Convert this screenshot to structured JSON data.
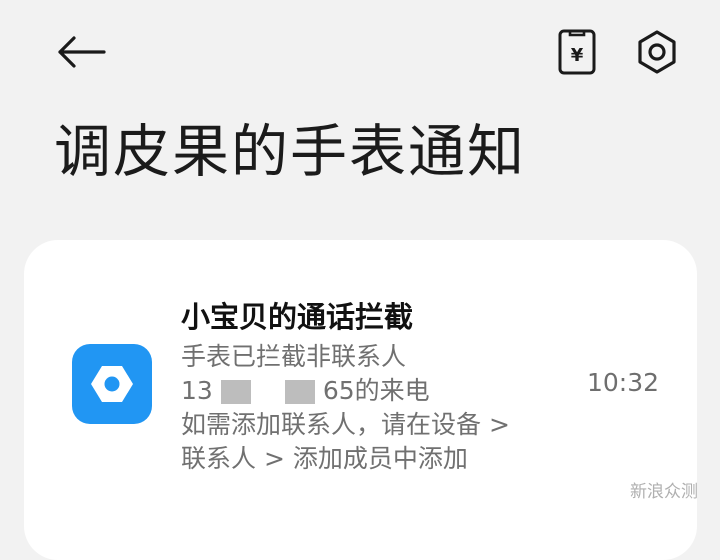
{
  "header": {
    "title": "调皮果的手表通知",
    "back_icon": "arrow-left-icon",
    "wallet_icon": "wallet-card-icon",
    "settings_icon": "hexagon-settings-icon",
    "wallet_symbol": "¥"
  },
  "notification": {
    "app_icon": "hexagon-bolt-icon",
    "app_icon_color": "#2196f3",
    "title": "小宝贝的通话拦截",
    "body_lines": [
      "手表已拦截非联系人",
      "13",
      "65的来电",
      "如需添加联系人，请在设备 >",
      "联系人 > 添加成员中添加"
    ],
    "time": "10:32"
  },
  "watermark": {
    "text": "新浪众测"
  },
  "colors": {
    "background": "#f2f2f2",
    "card": "#ffffff",
    "accent": "#2196f3",
    "text_primary": "#1b1b1b",
    "text_secondary": "#707070"
  }
}
